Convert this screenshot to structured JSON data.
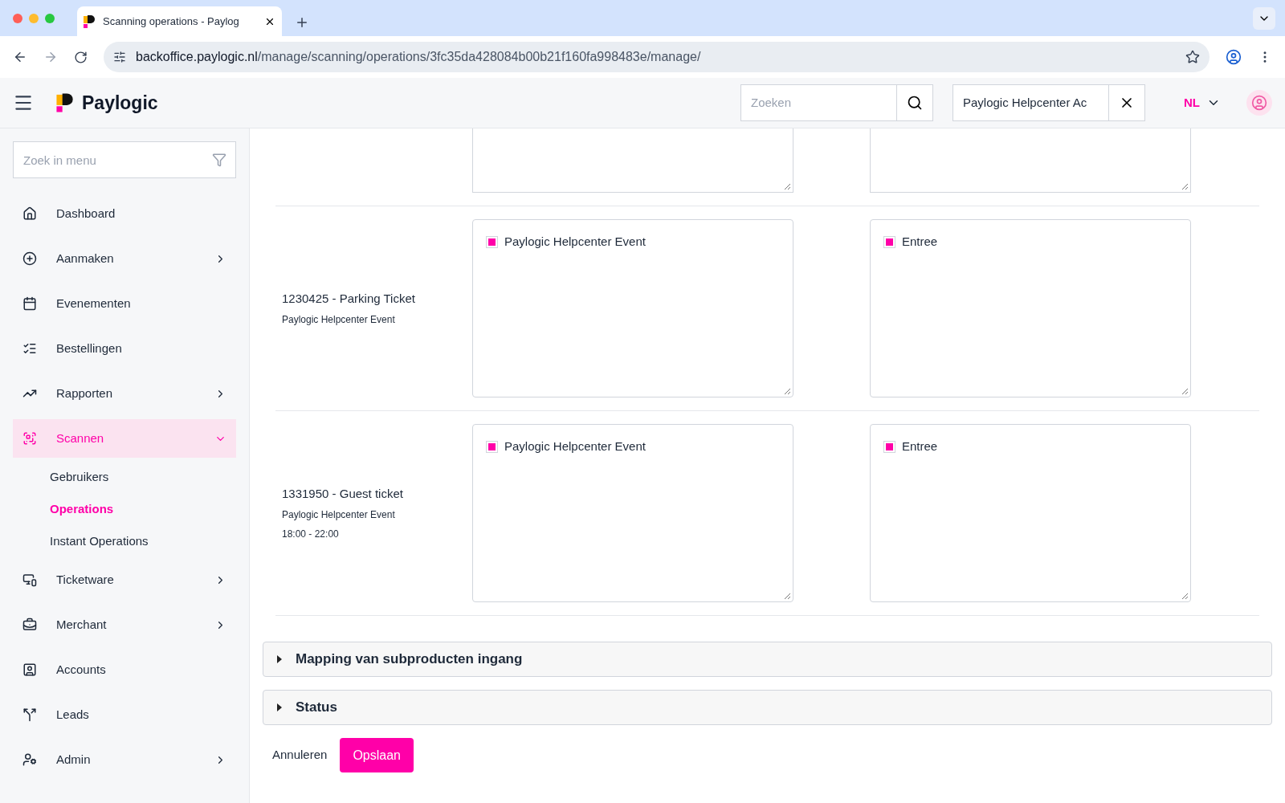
{
  "browser": {
    "tab_title": "Scanning operations - Paylog",
    "url_host": "backoffice.paylogic.nl",
    "url_path": "/manage/scanning/operations/3fc35da428084b00b21f160fa998483e/manage/"
  },
  "header": {
    "logo": "Paylogic",
    "search": {
      "placeholder": "Zoeken"
    },
    "account_field": {
      "value": "Paylogic Helpcenter Ac"
    },
    "language": "NL"
  },
  "sidebar": {
    "search": {
      "placeholder": "Zoek in menu"
    },
    "items": [
      {
        "kind": "home",
        "label": "Dashboard",
        "selected": false
      },
      {
        "kind": "create",
        "label": "Aanmaken",
        "expanded": false,
        "selected": false
      },
      {
        "kind": "calendar",
        "label": "Evenementen",
        "selected": false
      },
      {
        "kind": "orders",
        "label": "Bestellingen",
        "selected": false
      },
      {
        "kind": "reports",
        "label": "Rapporten",
        "expanded": false,
        "selected": false
      },
      {
        "kind": "scan",
        "label": "Scannen",
        "expanded": true,
        "selected": true,
        "children": [
          {
            "label": "Gebruikers",
            "selected": false
          },
          {
            "label": "Operations",
            "selected": true
          },
          {
            "label": "Instant Operations",
            "selected": false
          }
        ]
      },
      {
        "kind": "devices",
        "label": "Ticketware",
        "expanded": false,
        "selected": false
      },
      {
        "kind": "briefcase",
        "label": "Merchant",
        "expanded": false,
        "selected": false
      },
      {
        "kind": "account",
        "label": "Accounts",
        "selected": false
      },
      {
        "kind": "leads",
        "label": "Leads",
        "selected": false
      },
      {
        "kind": "admin",
        "label": "Admin",
        "expanded": false,
        "selected": false
      }
    ]
  },
  "mapping_rows": [
    {
      "lines": [],
      "events": [],
      "entrances": []
    },
    {
      "lines": [
        "1230425 - Parking Ticket",
        "Paylogic Helpcenter Event"
      ],
      "events": [
        {
          "label": "Paylogic Helpcenter Event",
          "checked": true
        }
      ],
      "entrances": [
        {
          "label": "Entree",
          "checked": true
        }
      ]
    },
    {
      "lines": [
        "1331950 - Guest ticket",
        "Paylogic Helpcenter Event",
        "18:00 - 22:00"
      ],
      "events": [
        {
          "label": "Paylogic Helpcenter Event",
          "checked": true
        }
      ],
      "entrances": [
        {
          "label": "Entree",
          "checked": true
        }
      ]
    }
  ],
  "sections": [
    {
      "title": "Mapping van subproducten ingang",
      "expanded": false
    },
    {
      "title": "Status",
      "expanded": false
    }
  ],
  "actions": {
    "cancel": "Annuleren",
    "save": "Opslaan"
  }
}
